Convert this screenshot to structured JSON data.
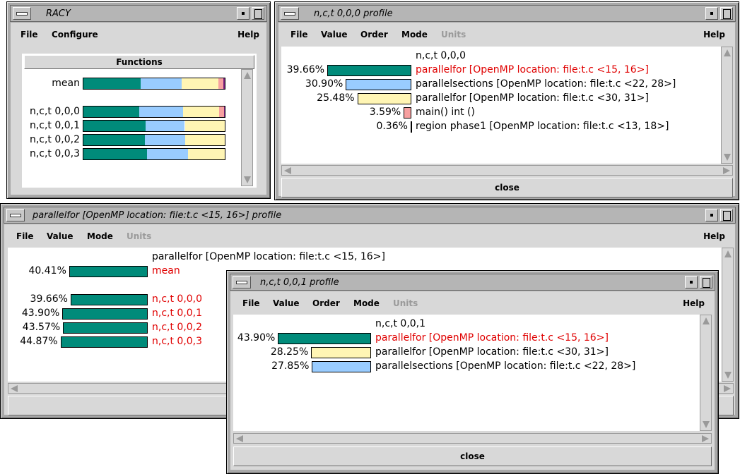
{
  "colors": {
    "teal": "#008b7a",
    "blue": "#99ccff",
    "yellow": "#fff5b4",
    "pink": "#f7a0a0",
    "purple": "#7a2080",
    "highlight": "#e00000"
  },
  "racy": {
    "title": "RACY",
    "menus": {
      "file": "File",
      "configure": "Configure",
      "help": "Help"
    },
    "functions_button": "Functions",
    "rows": [
      {
        "label": "mean",
        "segments": [
          40.41,
          28.9,
          26.0,
          3.5,
          0.8
        ]
      },
      {
        "label": "n,c,t 0,0,0",
        "segments": [
          39.66,
          30.9,
          25.48,
          3.59,
          0.36
        ]
      },
      {
        "label": "n,c,t 0,0,1",
        "segments": [
          43.9,
          27.85,
          28.25
        ]
      },
      {
        "label": "n,c,t 0,0,2",
        "segments": [
          43.57,
          28.5,
          27.93
        ]
      },
      {
        "label": "n,c,t 0,0,3",
        "segments": [
          44.87,
          29.0,
          26.13
        ]
      }
    ]
  },
  "profile000": {
    "title": "n,c,t 0,0,0 profile",
    "menus": {
      "file": "File",
      "value": "Value",
      "order": "Order",
      "mode": "Mode",
      "units": "Units",
      "help": "Help"
    },
    "heading": "n,c,t 0,0,0",
    "rows": [
      {
        "pct": "39.66%",
        "value": 39.66,
        "label": "parallelfor  [OpenMP location: file:t.c <15, 16>]",
        "color": "teal",
        "highlight": true
      },
      {
        "pct": "30.90%",
        "value": 30.9,
        "label": "parallelsections  [OpenMP location: file:t.c <22, 28>]",
        "color": "blue",
        "highlight": false
      },
      {
        "pct": "25.48%",
        "value": 25.48,
        "label": "parallelfor  [OpenMP location: file:t.c <30, 31>]",
        "color": "yellow",
        "highlight": false
      },
      {
        "pct": "3.59%",
        "value": 3.59,
        "label": "main() int ()",
        "color": "pink",
        "highlight": false
      },
      {
        "pct": "0.36%",
        "value": 0.36,
        "label": "region phase1 [OpenMP location: file:t.c <13, 18>]",
        "color": "purple",
        "highlight": false
      }
    ],
    "close": "close"
  },
  "pfprofile": {
    "title": "parallelfor  [OpenMP location: file:t.c <15, 16>] profile",
    "menus": {
      "file": "File",
      "value": "Value",
      "mode": "Mode",
      "units": "Units",
      "help": "Help"
    },
    "heading": "parallelfor  [OpenMP location: file:t.c <15, 16>]",
    "mean": {
      "pct": "40.41%",
      "value": 40.41,
      "label": "mean"
    },
    "rows": [
      {
        "pct": "39.66%",
        "value": 39.66,
        "label": "n,c,t 0,0,0"
      },
      {
        "pct": "43.90%",
        "value": 43.9,
        "label": "n,c,t 0,0,1"
      },
      {
        "pct": "43.57%",
        "value": 43.57,
        "label": "n,c,t 0,0,2"
      },
      {
        "pct": "44.87%",
        "value": 44.87,
        "label": "n,c,t 0,0,3"
      }
    ]
  },
  "profile001": {
    "title": "n,c,t 0,0,1 profile",
    "menus": {
      "file": "File",
      "value": "Value",
      "order": "Order",
      "mode": "Mode",
      "units": "Units",
      "help": "Help"
    },
    "heading": "n,c,t 0,0,1",
    "rows": [
      {
        "pct": "43.90%",
        "value": 43.9,
        "label": "parallelfor  [OpenMP location: file:t.c <15, 16>]",
        "color": "teal",
        "highlight": true
      },
      {
        "pct": "28.25%",
        "value": 28.25,
        "label": "parallelfor  [OpenMP location: file:t.c <30, 31>]",
        "color": "yellow",
        "highlight": false
      },
      {
        "pct": "27.85%",
        "value": 27.85,
        "label": "parallelsections  [OpenMP location: file:t.c <22, 28>]",
        "color": "blue",
        "highlight": false
      }
    ],
    "close": "close"
  }
}
